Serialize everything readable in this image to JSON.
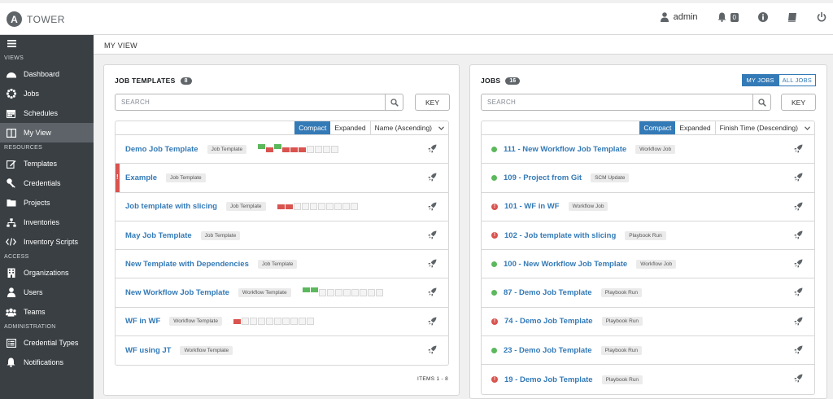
{
  "app": {
    "logo_letter": "A",
    "logo_text": "TOWER"
  },
  "topbar": {
    "user": "admin",
    "notifications_count": "0"
  },
  "sidebar": {
    "sections": [
      {
        "title": "VIEWS",
        "items": [
          {
            "label": "Dashboard",
            "icon": "dashboard-icon",
            "active": false
          },
          {
            "label": "Jobs",
            "icon": "spinner-icon",
            "active": false
          },
          {
            "label": "Schedules",
            "icon": "calendar-icon",
            "active": false
          },
          {
            "label": "My View",
            "icon": "columns-icon",
            "active": true
          }
        ]
      },
      {
        "title": "RESOURCES",
        "items": [
          {
            "label": "Templates",
            "icon": "edit-icon",
            "active": false
          },
          {
            "label": "Credentials",
            "icon": "key-icon",
            "active": false
          },
          {
            "label": "Projects",
            "icon": "folder-icon",
            "active": false
          },
          {
            "label": "Inventories",
            "icon": "sitemap-icon",
            "active": false
          },
          {
            "label": "Inventory Scripts",
            "icon": "code-icon",
            "active": false
          }
        ]
      },
      {
        "title": "ACCESS",
        "items": [
          {
            "label": "Organizations",
            "icon": "building-icon",
            "active": false
          },
          {
            "label": "Users",
            "icon": "user-icon",
            "active": false
          },
          {
            "label": "Teams",
            "icon": "users-icon",
            "active": false
          }
        ]
      },
      {
        "title": "ADMINISTRATION",
        "items": [
          {
            "label": "Credential Types",
            "icon": "list-alt-icon",
            "active": false
          },
          {
            "label": "Notifications",
            "icon": "bell-icon",
            "active": false
          }
        ]
      }
    ]
  },
  "breadcrumb": "MY VIEW",
  "job_templates": {
    "title": "JOB TEMPLATES",
    "count": "8",
    "search_placeholder": "SEARCH",
    "key_label": "KEY",
    "toggle_compact": "Compact",
    "toggle_expanded": "Expanded",
    "sort_label": "Name (Ascending)",
    "items_label": "ITEMS  1 - 8",
    "rows": [
      {
        "name": "Demo Job Template",
        "type": "Job Template",
        "error": false,
        "runs": [
          "s",
          "f",
          "s",
          "f",
          "f",
          "f",
          "e",
          "e",
          "e",
          "e"
        ]
      },
      {
        "name": "Example",
        "type": "Job Template",
        "error": true,
        "runs": []
      },
      {
        "name": "Job template with slicing",
        "type": "Job Template",
        "error": false,
        "runs": [
          "f",
          "f",
          "e",
          "e",
          "e",
          "e",
          "e",
          "e",
          "e",
          "e"
        ]
      },
      {
        "name": "May Job Template",
        "type": "Job Template",
        "error": false,
        "runs": []
      },
      {
        "name": "New Template with Dependencies",
        "type": "Job Template",
        "error": false,
        "runs": []
      },
      {
        "name": "New Workflow Job Template",
        "type": "Workflow Template",
        "error": false,
        "runs": [
          "s",
          "s",
          "e",
          "e",
          "e",
          "e",
          "e",
          "e",
          "e",
          "e"
        ]
      },
      {
        "name": "WF in WF",
        "type": "Workflow Template",
        "error": false,
        "runs": [
          "f",
          "e",
          "e",
          "e",
          "e",
          "e",
          "e",
          "e",
          "e",
          "e"
        ]
      },
      {
        "name": "WF using JT",
        "type": "Workflow Template",
        "error": false,
        "runs": []
      }
    ]
  },
  "jobs": {
    "title": "JOBS",
    "count": "16",
    "my_jobs": "MY JOBS",
    "all_jobs": "ALL JOBS",
    "search_placeholder": "SEARCH",
    "key_label": "KEY",
    "toggle_compact": "Compact",
    "toggle_expanded": "Expanded",
    "sort_label": "Finish Time (Descending)",
    "rows": [
      {
        "name": "111 - New Workflow Job Template",
        "type": "Workflow Job",
        "status": "success"
      },
      {
        "name": "109 - Project from Git",
        "type": "SCM Update",
        "status": "success"
      },
      {
        "name": "101 - WF in WF",
        "type": "Workflow Job",
        "status": "failed"
      },
      {
        "name": "102 - Job template with slicing",
        "type": "Playbook Run",
        "status": "failed"
      },
      {
        "name": "100 - New Workflow Job Template",
        "type": "Workflow Job",
        "status": "success"
      },
      {
        "name": "87 - Demo Job Template",
        "type": "Playbook Run",
        "status": "success"
      },
      {
        "name": "74 - Demo Job Template",
        "type": "Playbook Run",
        "status": "failed"
      },
      {
        "name": "23 - Demo Job Template",
        "type": "Playbook Run",
        "status": "success"
      },
      {
        "name": "19 - Demo Job Template",
        "type": "Playbook Run",
        "status": "failed"
      }
    ]
  },
  "colors": {
    "link": "#337ab7",
    "success": "#5cb85c",
    "failed": "#d9534f",
    "sidebar": "#393f43",
    "sidebar_active": "#5d6368"
  }
}
